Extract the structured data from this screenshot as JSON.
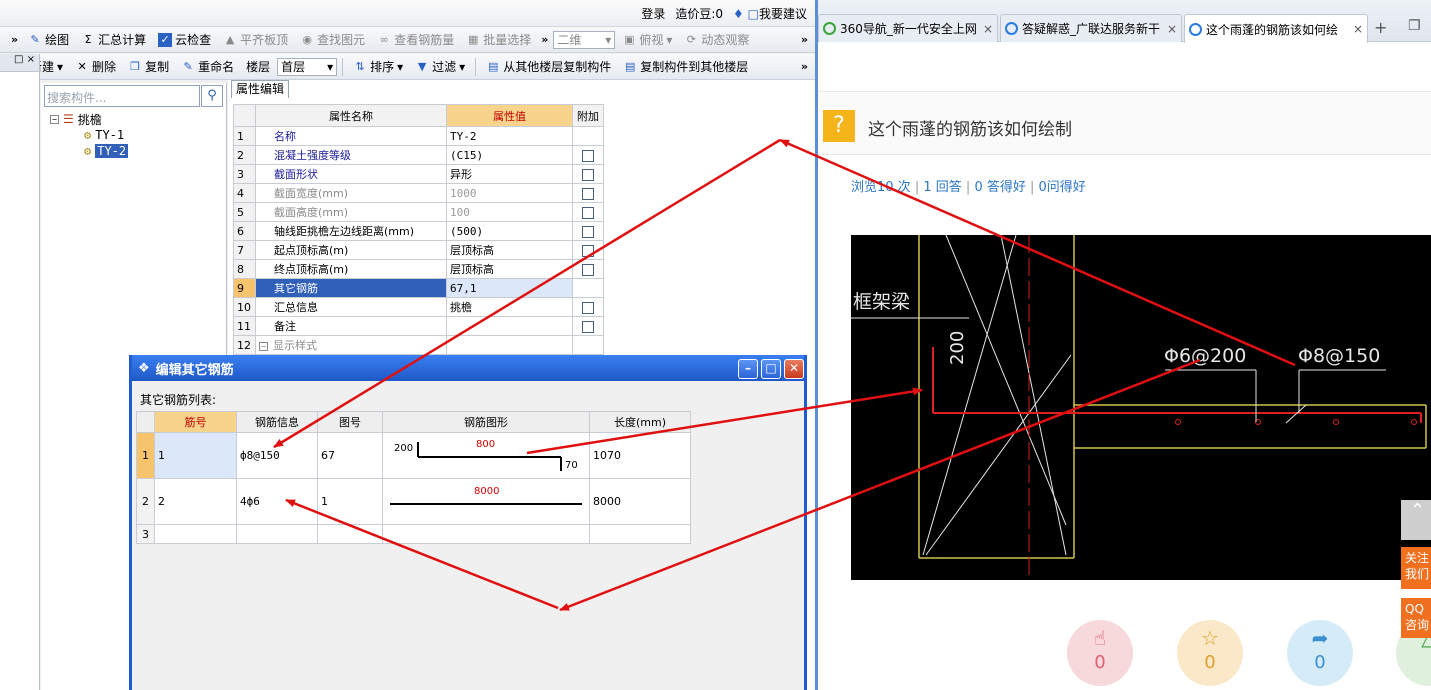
{
  "app": {
    "topbar": {
      "login": "登录",
      "price_beans": "造价豆:0",
      "suggest": "我要建议"
    },
    "toolbar1": {
      "draw": "绘图",
      "sum_calc": "汇总计算",
      "cloud_check": "云检查",
      "flush_slab": "平齐板顶",
      "find_element": "查找图元",
      "view_rebar": "查看钢筋量",
      "batch_select": "批量选择",
      "view_mode": "二维",
      "top_view": "俯视",
      "dynamic_view": "动态观察"
    },
    "toolbar2": {
      "new": "新建",
      "delete": "删除",
      "copy": "复制",
      "rename": "重命名",
      "floor_label": "楼层",
      "floor_value": "首层",
      "sort": "排序",
      "filter": "过滤",
      "copy_from_floor": "从其他楼层复制构件",
      "copy_to_floor": "复制构件到其他楼层"
    },
    "tree": {
      "search_placeholder": "搜索构件...",
      "root": "挑檐",
      "items": [
        "TY-1",
        "TY-2"
      ]
    },
    "props": {
      "tab": "属性编辑",
      "col_name": "属性名称",
      "col_value": "属性值",
      "col_extra": "附加",
      "rows": [
        {
          "n": "1",
          "name": "名称",
          "value": "TY-2"
        },
        {
          "n": "2",
          "name": "混凝土强度等级",
          "value": "(C15)"
        },
        {
          "n": "3",
          "name": "截面形状",
          "value": "异形"
        },
        {
          "n": "4",
          "name": "截面宽度(mm)",
          "value": "1000"
        },
        {
          "n": "5",
          "name": "截面高度(mm)",
          "value": "100"
        },
        {
          "n": "6",
          "name": "轴线距挑檐左边线距离(mm)",
          "value": "(500)"
        },
        {
          "n": "7",
          "name": "起点顶标高(m)",
          "value": "层顶标高"
        },
        {
          "n": "8",
          "name": "终点顶标高(m)",
          "value": "层顶标高"
        },
        {
          "n": "9",
          "name": "其它钢筋",
          "value": "67,1"
        },
        {
          "n": "10",
          "name": "汇总信息",
          "value": "挑檐"
        },
        {
          "n": "11",
          "name": "备注",
          "value": ""
        },
        {
          "n": "12",
          "name": "显示样式",
          "value": ""
        }
      ]
    }
  },
  "dialog": {
    "title": "编辑其它钢筋",
    "list_label": "其它钢筋列表:",
    "headers": [
      "筋号",
      "钢筋信息",
      "图号",
      "钢筋图形",
      "长度(mm)"
    ],
    "rows": [
      {
        "rn": "1",
        "bar_no": "1",
        "info": "ф8@150",
        "fig": "67",
        "dims": {
          "left": "200",
          "top": "800",
          "right": "70"
        },
        "length": "1070"
      },
      {
        "rn": "2",
        "bar_no": "2",
        "info": "4ф6",
        "fig": "1",
        "dims": {
          "top": "8000"
        },
        "length": "8000"
      },
      {
        "rn": "3",
        "bar_no": "",
        "info": "",
        "fig": "",
        "dims": {},
        "length": ""
      }
    ]
  },
  "browser": {
    "tabs": [
      {
        "title": "360导航_新一代安全上网"
      },
      {
        "title": "答疑解惑_广联达服务新干"
      },
      {
        "title": "这个雨蓬的钢筋该如何绘"
      }
    ],
    "question": {
      "title": "这个雨蓬的钢筋该如何绘制",
      "views": "浏览10 次",
      "answers": "1 回答",
      "good_answers": "0 答得好",
      "good_questions": "0问得好"
    },
    "cad": {
      "beam_label": "框架梁",
      "dim_200": "200",
      "rebar_a": "Φ6@200",
      "rebar_b": "Φ8@150"
    },
    "actions": [
      {
        "icon": "thumb-up-icon",
        "count": "0",
        "color": "#f7d9dc"
      },
      {
        "icon": "star-icon",
        "count": "0",
        "color": "#fbe8c8"
      },
      {
        "icon": "share-icon",
        "count": "0",
        "color": "#d6ebf8"
      }
    ],
    "side": {
      "follow": "关注我们",
      "qq": "QQ咨询"
    }
  },
  "colors": {
    "selection_blue": "#3060b8",
    "header_orange": "#f8d38c",
    "dialog_blue": "#1f5cd0",
    "arrow_red": "#e01010",
    "link_blue": "#2b77c9",
    "cad_yellow": "#cfc24a"
  }
}
